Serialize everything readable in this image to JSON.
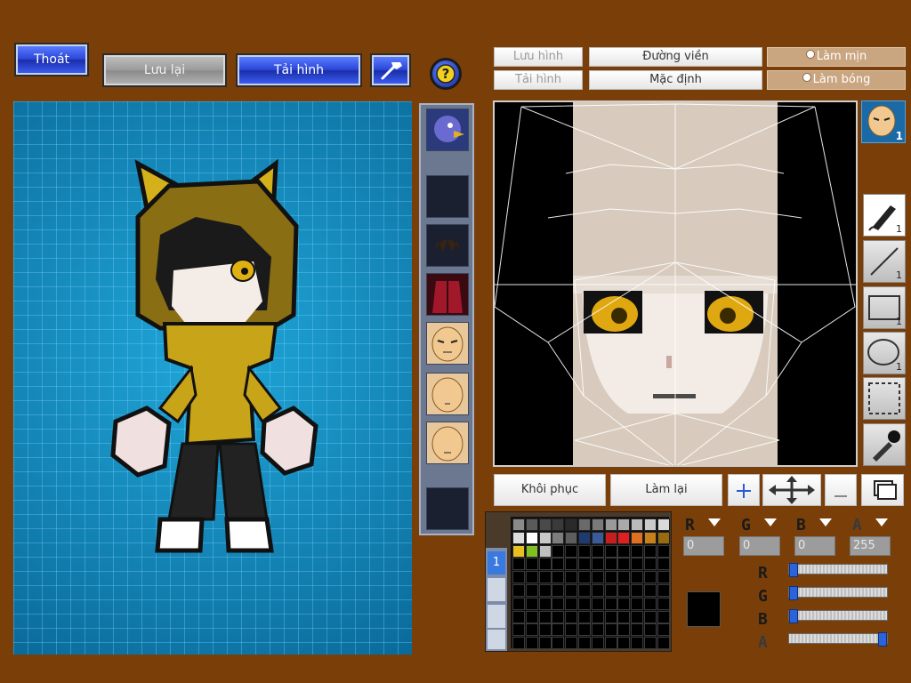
{
  "top_left_buttons": {
    "exit": "Thoát",
    "save": "Lưu lại",
    "reload": "Tải hình",
    "hammer_icon": "hammer-icon",
    "help_icon": "help-icon"
  },
  "editor_toolbar": {
    "save_image": "Lưu hình",
    "outline": "Đường viền",
    "smooth": "Làm mịn",
    "load_image": "Tải hình",
    "default": "Mặc định",
    "shade": "Làm bóng"
  },
  "tools": [
    {
      "name": "brush-icon",
      "count": "1"
    },
    {
      "name": "line-icon",
      "count": "1"
    },
    {
      "name": "rectangle-icon",
      "count": "1"
    },
    {
      "name": "ellipse-icon",
      "count": "1"
    },
    {
      "name": "select-icon",
      "count": ""
    },
    {
      "name": "eyedropper-icon",
      "count": ""
    }
  ],
  "face_thumb_count": "1",
  "bottom_buttons": {
    "restore": "Khôi phục",
    "redo": "Làm lại"
  },
  "color": {
    "r_label": "R",
    "g_label": "G",
    "b_label": "B",
    "a_label": "A",
    "r": "0",
    "g": "0",
    "b": "0",
    "a": "255",
    "current": "#000000",
    "slider_fraction": {
      "r": 0,
      "g": 0,
      "b": 0,
      "a": 1
    }
  },
  "palette_swatches": [
    "#8a8a8a",
    "#5a5a5a",
    "#4a4a4a",
    "#3a3a3a",
    "#2a2a2a",
    "#6a6a6a",
    "#7a7a7a",
    "#9a9a9a",
    "#aaaaaa",
    "#bababa",
    "#cacaca",
    "#dadada",
    "#dddddd",
    "#ffffff",
    "#c8c8c8",
    "#7d7d7d",
    "#5e5e5e",
    "#1e3a6e",
    "#3a5a9a",
    "#c81e1e",
    "#e02020",
    "#e07020",
    "#c88018",
    "#9a6a10",
    "#e8c020",
    "#80c020",
    "#c0c0c0"
  ],
  "palette_tab": "1"
}
